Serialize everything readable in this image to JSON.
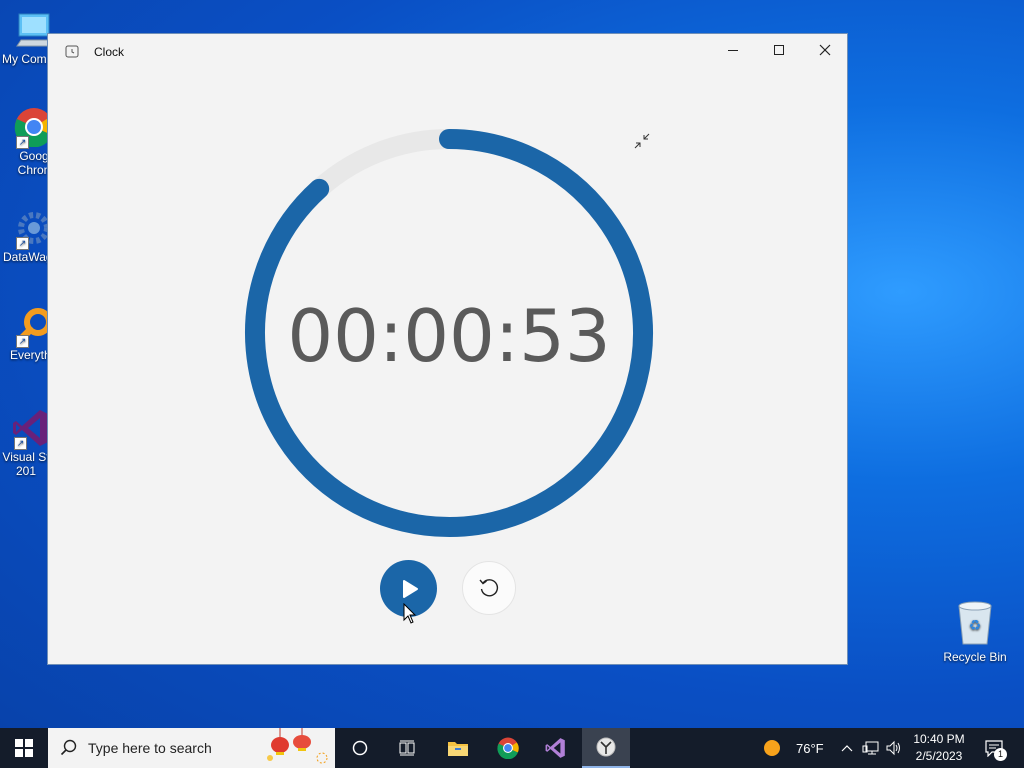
{
  "desktop": {
    "icons": [
      {
        "label": "My Com"
      },
      {
        "label": "Goog Chron"
      },
      {
        "label": "DataWag"
      },
      {
        "label": "Everyth"
      },
      {
        "label": "Visual St 201"
      },
      {
        "label": "Recycle Bin"
      }
    ]
  },
  "window": {
    "title": "Clock",
    "stopwatch": {
      "time": "00:00:53",
      "progress_seconds": 53,
      "ring_color": "#1b66a8",
      "track_color": "#e8e8e8"
    }
  },
  "taskbar": {
    "search_placeholder": "Type here to search",
    "weather_temp": "76°F",
    "clock_time": "10:40 PM",
    "clock_date": "2/5/2023",
    "notification_count": "1"
  }
}
